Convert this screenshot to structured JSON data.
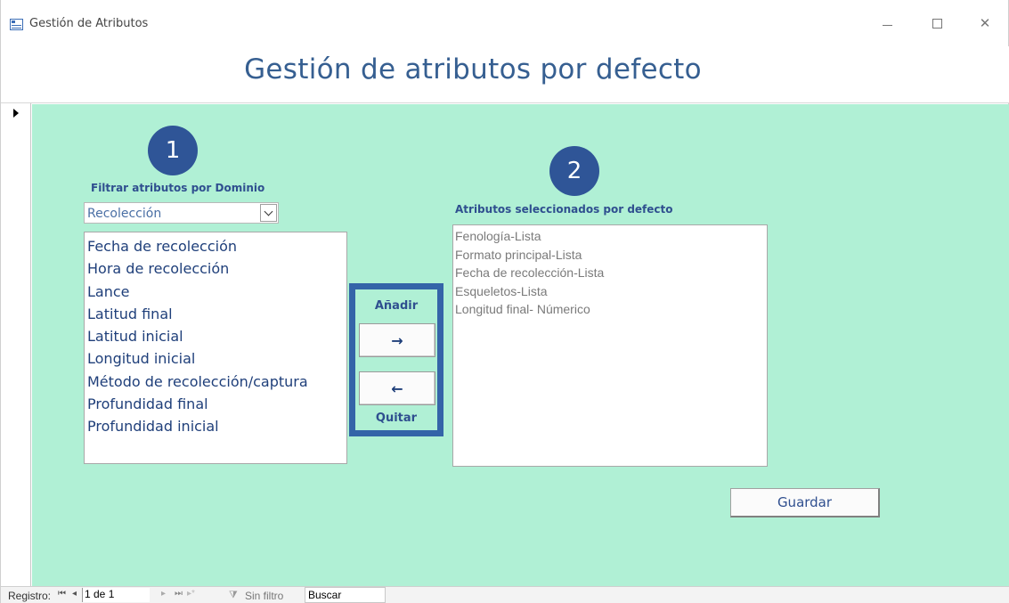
{
  "window": {
    "title": "Gestión de Atributos"
  },
  "header": {
    "title": "Gestión de atributos por defecto"
  },
  "step_badges": [
    "1",
    "2"
  ],
  "filter": {
    "label": "Filtrar atributos por Dominio",
    "selected": "Recolección"
  },
  "available_attributes": [
    "Fecha de recolección",
    "Hora de recolección",
    "Lance",
    "Latitud final",
    "Latitud inicial",
    "Longitud inicial",
    "Método de recolección/captura",
    "Profundidad final",
    "Profundidad inicial"
  ],
  "actions": {
    "add_label": "Añadir",
    "remove_label": "Quitar",
    "add_glyph": "→",
    "remove_glyph": "←"
  },
  "selected_attributes": {
    "label": "Atributos seleccionados por defecto",
    "items": [
      "Fenología-Lista",
      "Formato principal-Lista",
      "Fecha de recolección-Lista",
      "Esqueletos-Lista",
      "Longitud final- Númerico"
    ]
  },
  "save_label": "Guardar",
  "status": {
    "record_label": "Registro:",
    "record_position": "1 de 1",
    "filter_label": "Sin filtro",
    "search_placeholder": "Buscar"
  },
  "colors": {
    "form_background": "#b0f0d5",
    "accent": "#2f5597",
    "title": "#365f91"
  }
}
